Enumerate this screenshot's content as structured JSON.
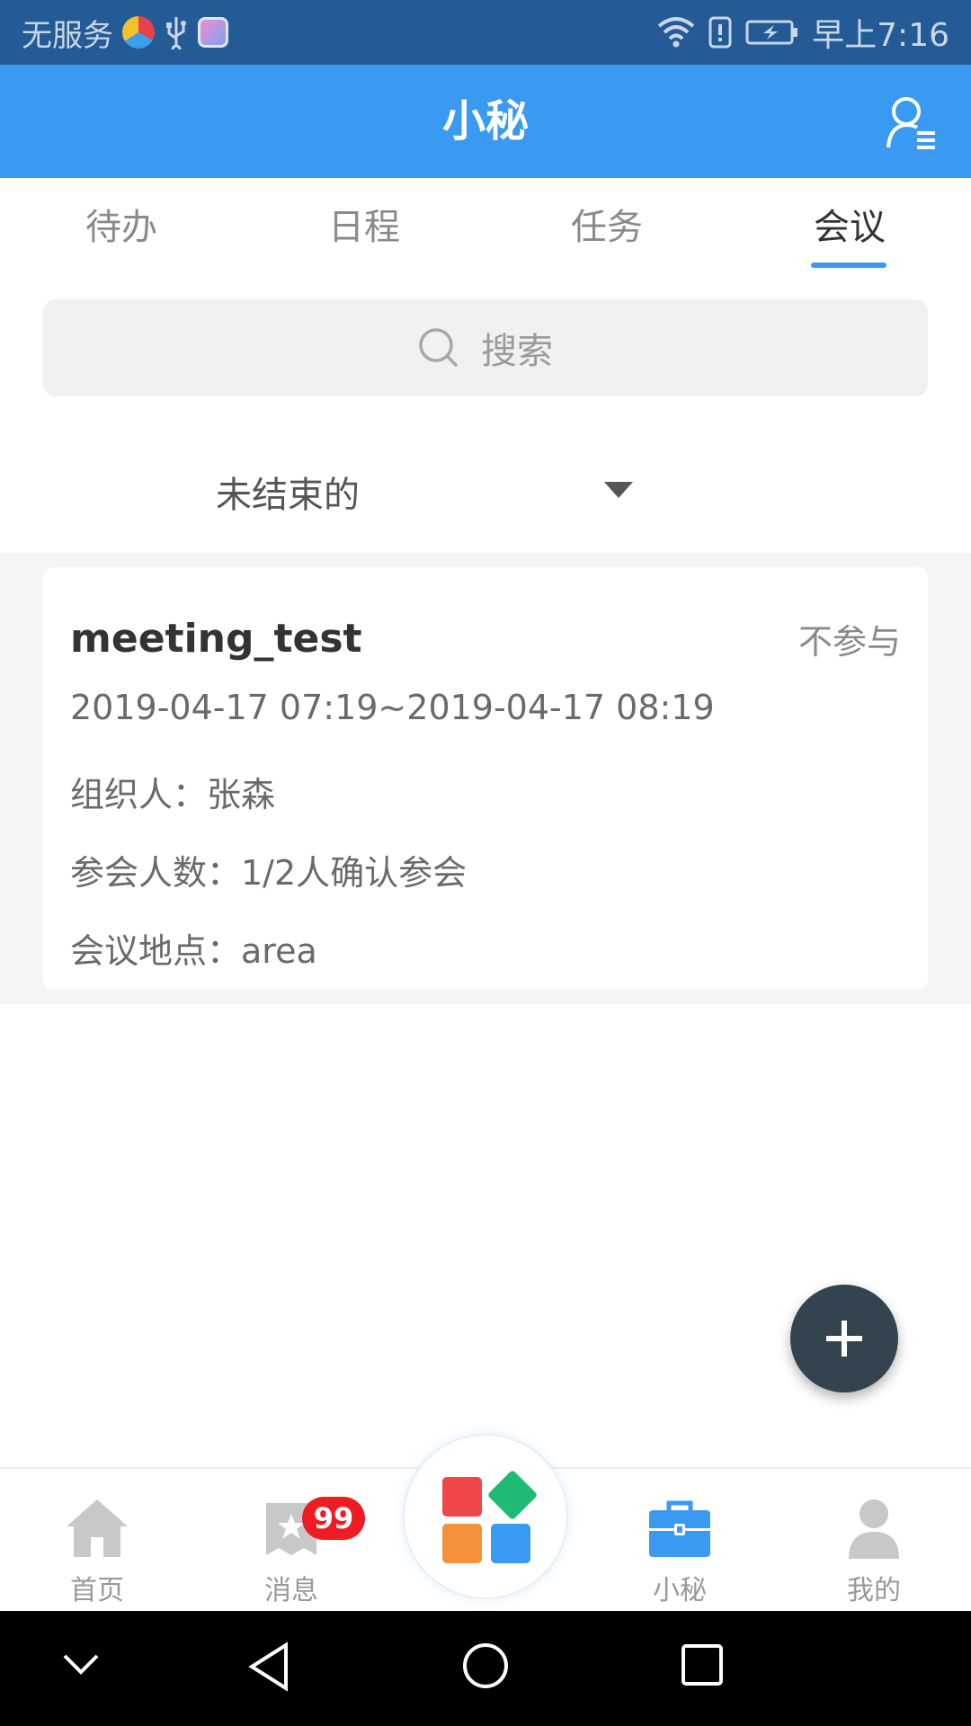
{
  "status_bar": {
    "carrier": "无服务",
    "time": "早上7:16",
    "icons": [
      "app-icon",
      "usb-icon",
      "app-square-icon",
      "wifi-icon",
      "alert-icon",
      "battery-icon"
    ]
  },
  "app_bar": {
    "title": "小秘",
    "profile_icon": "user-menu-icon"
  },
  "tabs": [
    {
      "label": "待办",
      "active": false
    },
    {
      "label": "日程",
      "active": false
    },
    {
      "label": "任务",
      "active": false
    },
    {
      "label": "会议",
      "active": true
    }
  ],
  "search": {
    "placeholder": "搜索",
    "icon": "search-icon"
  },
  "filter": {
    "selected": "未结束的",
    "icon": "caret-down-icon"
  },
  "meetings": [
    {
      "title": "meeting_test",
      "action": "不参与",
      "time": "2019-04-17 07:19~2019-04-17 08:19",
      "organizer": "组织人：张森",
      "attendees": "参会人数：1/2人确认参会",
      "location": "会议地点：area"
    }
  ],
  "fab": {
    "icon": "plus-icon"
  },
  "bottom_nav": [
    {
      "label": "首页",
      "icon": "home-icon",
      "active": false
    },
    {
      "label": "消息",
      "icon": "message-icon",
      "active": false,
      "badge": "99"
    },
    {
      "label": "",
      "icon": "apps-grid-icon",
      "active": false
    },
    {
      "label": "小秘",
      "icon": "briefcase-icon",
      "active": true
    },
    {
      "label": "我的",
      "icon": "person-icon",
      "active": false
    }
  ],
  "colors": {
    "status_bar": "#245b96",
    "primary": "#3a99f0",
    "fab": "#34444f",
    "badge": "#ee1d24"
  }
}
